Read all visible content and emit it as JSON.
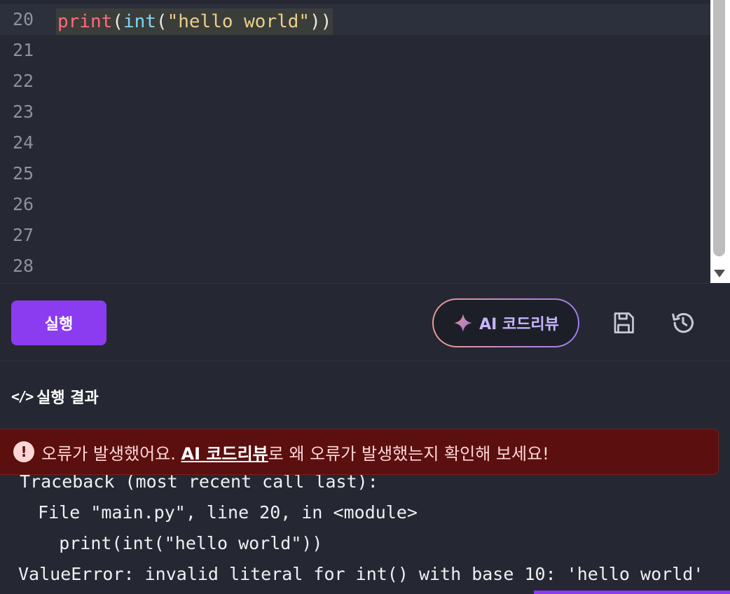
{
  "editor": {
    "lines": [
      {
        "no": "20",
        "tokens": {
          "fn": "print",
          "p1": "(",
          "builtin": "int",
          "p2": "(",
          "str": "\"hello world\"",
          "p3": "))"
        }
      },
      {
        "no": "21"
      },
      {
        "no": "22"
      },
      {
        "no": "23"
      },
      {
        "no": "24"
      },
      {
        "no": "25"
      },
      {
        "no": "26"
      },
      {
        "no": "27"
      },
      {
        "no": "28"
      }
    ]
  },
  "toolbar": {
    "run_label": "실행",
    "review_label": "AI 코드리뷰",
    "save_icon": "save-icon",
    "history_icon": "history-icon"
  },
  "result": {
    "heading": "실행 결과",
    "heading_icon": "</>",
    "error": {
      "icon": "!",
      "prefix": "오류가 발생했어요.",
      "link": "AI 코드리뷰",
      "suffix": "로 왜 오류가 발생했는지 확인해 보세요!"
    },
    "output_lines": [
      "Traceback (most recent call last):",
      "  File \"main.py\", line 20, in <module>",
      "    print(int(\"hello world\"))",
      "ValueError: invalid literal for int() with base 10: 'hello world'"
    ]
  },
  "colors": {
    "accent": "#8b3cf0",
    "background": "#252733",
    "error_bg": "#5b0f0f"
  }
}
